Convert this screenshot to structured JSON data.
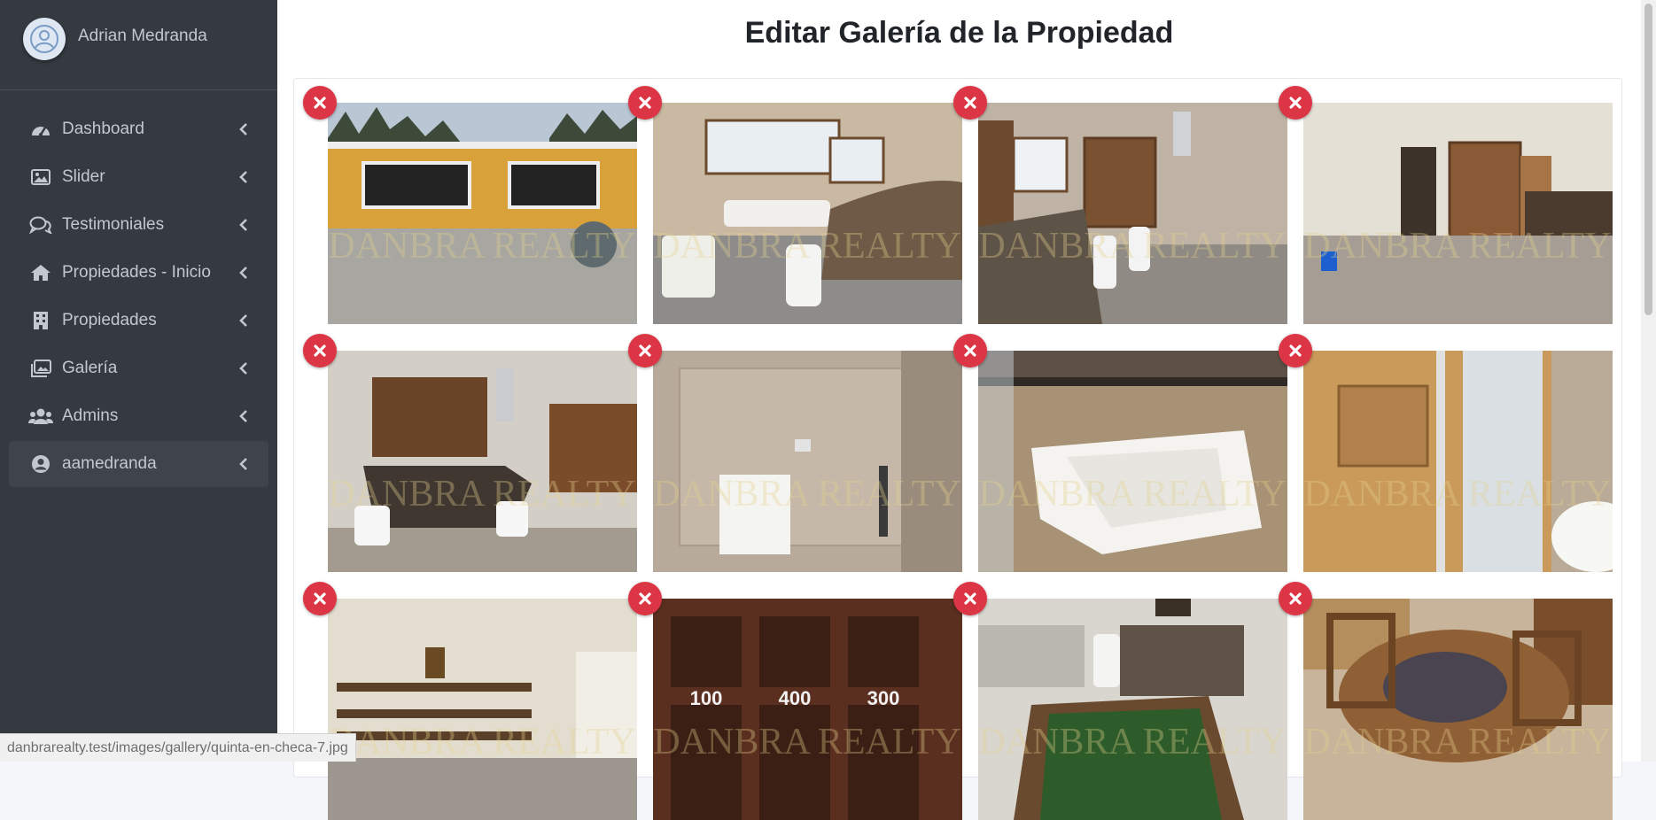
{
  "user": {
    "name": "Adrian Medranda"
  },
  "nav": [
    {
      "label": "Dashboard",
      "icon": "dashboard-gauge-icon"
    },
    {
      "label": "Slider",
      "icon": "image-icon"
    },
    {
      "label": "Testimoniales",
      "icon": "comments-icon"
    },
    {
      "label": "Propiedades - Inicio",
      "icon": "home-icon"
    },
    {
      "label": "Propiedades",
      "icon": "building-icon"
    },
    {
      "label": "Galería",
      "icon": "images-icon"
    },
    {
      "label": "Admins",
      "icon": "users-icon"
    },
    {
      "label": "aamedranda",
      "icon": "user-circle-icon",
      "active": true
    }
  ],
  "page": {
    "title": "Editar Galería de la Propiedad"
  },
  "gallery": {
    "watermark": "DANBRA REALTY",
    "images": [
      {
        "scene": "house-exterior-yellow"
      },
      {
        "scene": "living-room-sofas"
      },
      {
        "scene": "kitchen-bar-stools"
      },
      {
        "scene": "empty-room-wood-doors"
      },
      {
        "scene": "kitchen-island-cabinets"
      },
      {
        "scene": "laundry-room-sink"
      },
      {
        "scene": "jacuzzi-bathtub"
      },
      {
        "scene": "sauna-shower"
      },
      {
        "scene": "room-shelves-ceiling-fan"
      },
      {
        "scene": "wood-cubby-shelves"
      },
      {
        "scene": "foosball-bar-area"
      },
      {
        "scene": "round-wood-dining-table"
      }
    ],
    "cubby_labels": [
      "100",
      "400",
      "300"
    ]
  },
  "status_bar": {
    "url": "danbrarealty.test/images/gallery/quinta-en-checa-7.jpg"
  },
  "colors": {
    "sidebar": "#343a40",
    "delete": "#dc3545",
    "text": "#c2c7d0"
  }
}
